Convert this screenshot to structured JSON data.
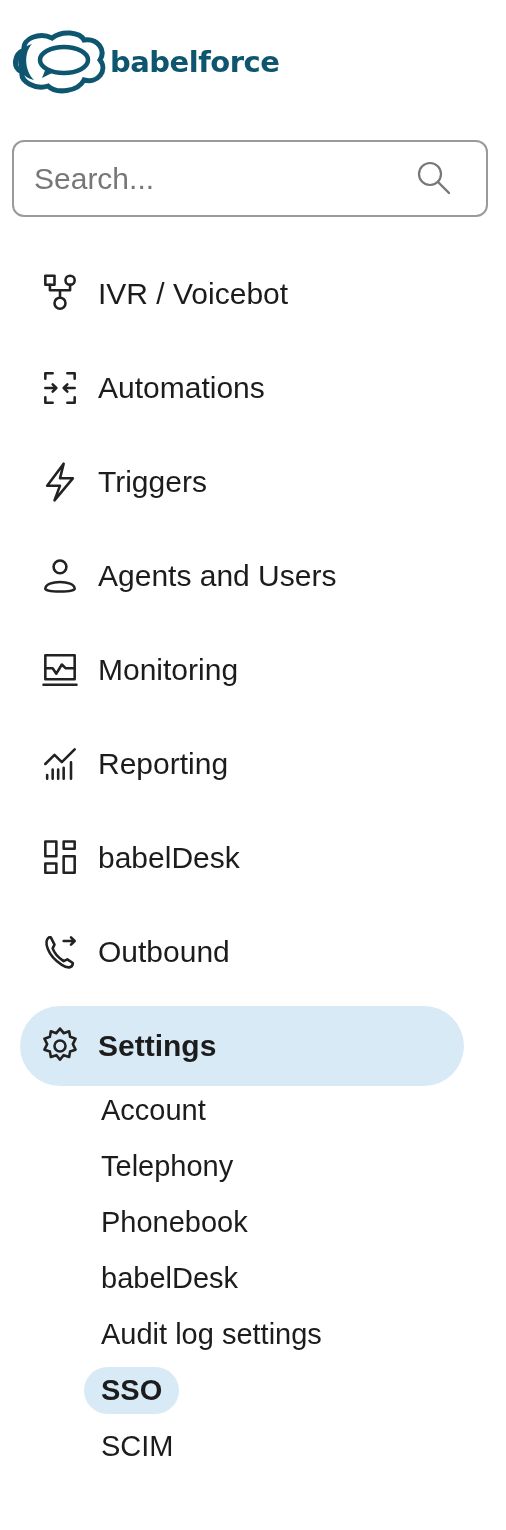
{
  "logo": {
    "text": "babelforce"
  },
  "search": {
    "placeholder": "Search..."
  },
  "nav": [
    {
      "label": "IVR / Voicebot",
      "selected": false
    },
    {
      "label": "Automations",
      "selected": false
    },
    {
      "label": "Triggers",
      "selected": false
    },
    {
      "label": "Agents and Users",
      "selected": false
    },
    {
      "label": "Monitoring",
      "selected": false
    },
    {
      "label": "Reporting",
      "selected": false
    },
    {
      "label": "babelDesk",
      "selected": false
    },
    {
      "label": "Outbound",
      "selected": false
    },
    {
      "label": "Settings",
      "selected": true,
      "expanded": true,
      "children": [
        {
          "label": "Account",
          "selected": false
        },
        {
          "label": "Telephony",
          "selected": false
        },
        {
          "label": "Phonebook",
          "selected": false
        },
        {
          "label": "babelDesk",
          "selected": false
        },
        {
          "label": "Audit log settings",
          "selected": false
        },
        {
          "label": "SSO",
          "selected": true
        },
        {
          "label": "SCIM",
          "selected": false
        }
      ]
    }
  ]
}
